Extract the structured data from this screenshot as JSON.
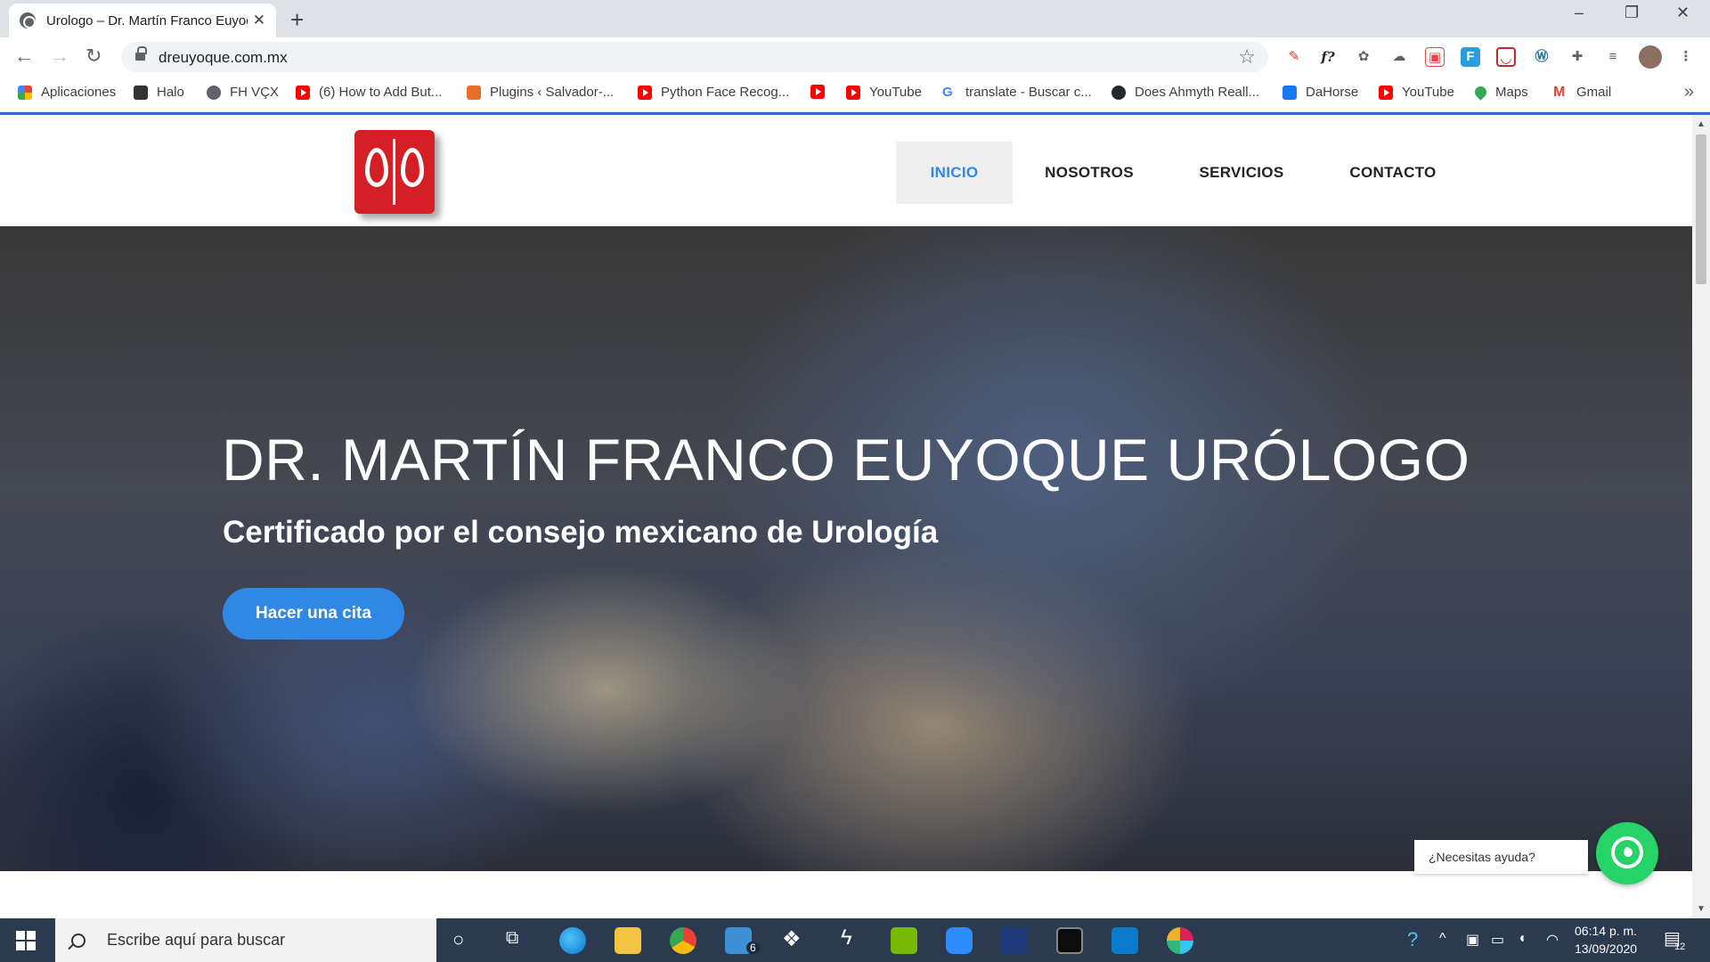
{
  "browser": {
    "tab_title": "Urologo – Dr. Martín Franco Euyoque",
    "url": "dreuyoque.com.mx",
    "window_controls": [
      "–",
      "❐",
      "✕"
    ]
  },
  "bookmarks": [
    {
      "label": "Aplicaciones",
      "icon": "apps-grid-icon",
      "color": "#1a73e8"
    },
    {
      "label": "Halo",
      "icon": "halo-icon",
      "color": "#333333"
    },
    {
      "label": "FH VÇX",
      "icon": "globe-icon",
      "color": "#5f6368"
    },
    {
      "label": "(6) How to Add But...",
      "icon": "youtube-icon",
      "color": "#ff0000"
    },
    {
      "label": "Plugins ‹ Salvador-...",
      "icon": "plugin-icon",
      "color": "#e76f2a"
    },
    {
      "label": "Python Face Recog...",
      "icon": "youtube-icon",
      "color": "#ff0000"
    },
    {
      "label": "",
      "icon": "youtube-icon",
      "color": "#ff0000"
    },
    {
      "label": "YouTube",
      "icon": "youtube-icon",
      "color": "#ff0000"
    },
    {
      "label": "translate - Buscar c...",
      "icon": "google-icon",
      "color": "#4285f4"
    },
    {
      "label": "Does Ahmyth Reall...",
      "icon": "github-icon",
      "color": "#24292e"
    },
    {
      "label": "DaHorse",
      "icon": "facebook-icon",
      "color": "#1877f2"
    },
    {
      "label": "YouTube",
      "icon": "youtube-icon",
      "color": "#ff0000"
    },
    {
      "label": "Maps",
      "icon": "maps-icon",
      "color": "#34a853"
    },
    {
      "label": "Gmail",
      "icon": "gmail-icon",
      "color": "#ea4335"
    }
  ],
  "site": {
    "nav": [
      "INICIO",
      "NOSOTROS",
      "SERVICIOS",
      "CONTACTO"
    ],
    "active_nav": "INICIO",
    "hero_title": "DR. MARTÍN FRANCO EUYOQUE URÓLOGO",
    "hero_subtitle": "Certificado por el consejo mexicano de Urología",
    "cta_label": "Hacer una cita",
    "help_text": "¿Necesitas ayuda?",
    "accent_color": "#2f88e6",
    "logo_color": "#d51f26"
  },
  "taskbar": {
    "search_placeholder": "Escribe aquí para buscar",
    "mail_badge": "6",
    "time": "06:14 p. m.",
    "date": "13/09/2020",
    "notifications_count": "12"
  }
}
